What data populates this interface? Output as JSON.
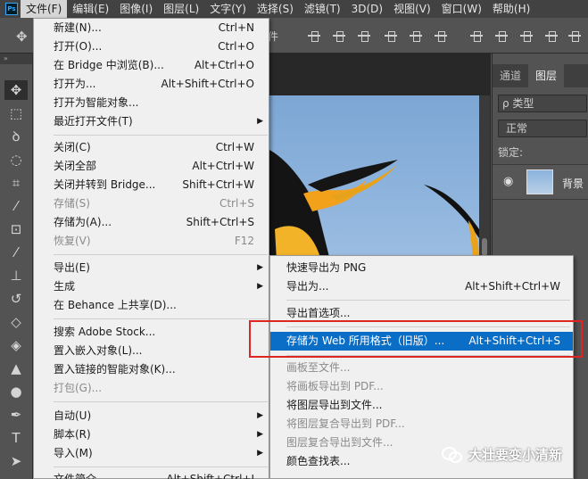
{
  "app": {
    "logo": "Ps"
  },
  "menubar": [
    "文件(F)",
    "编辑(E)",
    "图像(I)",
    "图层(L)",
    "文字(Y)",
    "选择(S)",
    "滤镜(T)",
    "3D(D)",
    "视图(V)",
    "窗口(W)",
    "帮助(H)"
  ],
  "optbar": {
    "text": "件"
  },
  "file_menu": [
    {
      "label": "新建(N)...",
      "shortcut": "Ctrl+N"
    },
    {
      "label": "打开(O)...",
      "shortcut": "Ctrl+O"
    },
    {
      "label": "在 Bridge 中浏览(B)...",
      "shortcut": "Alt+Ctrl+O"
    },
    {
      "label": "打开为...",
      "shortcut": "Alt+Shift+Ctrl+O"
    },
    {
      "label": "打开为智能对象...",
      "shortcut": ""
    },
    {
      "label": "最近打开文件(T)",
      "shortcut": ""
    },
    {
      "label": "关闭(C)",
      "shortcut": "Ctrl+W"
    },
    {
      "label": "关闭全部",
      "shortcut": "Alt+Ctrl+W"
    },
    {
      "label": "关闭并转到 Bridge...",
      "shortcut": "Shift+Ctrl+W"
    },
    {
      "label": "存储(S)",
      "shortcut": "Ctrl+S"
    },
    {
      "label": "存储为(A)...",
      "shortcut": "Shift+Ctrl+S"
    },
    {
      "label": "恢复(V)",
      "shortcut": "F12"
    },
    {
      "label": "导出(E)",
      "shortcut": ""
    },
    {
      "label": "生成",
      "shortcut": ""
    },
    {
      "label": "在 Behance 上共享(D)...",
      "shortcut": ""
    },
    {
      "label": "搜索 Adobe Stock...",
      "shortcut": ""
    },
    {
      "label": "置入嵌入对象(L)...",
      "shortcut": ""
    },
    {
      "label": "置入链接的智能对象(K)...",
      "shortcut": ""
    },
    {
      "label": "打包(G)...",
      "shortcut": ""
    },
    {
      "label": "自动(U)",
      "shortcut": ""
    },
    {
      "label": "脚本(R)",
      "shortcut": ""
    },
    {
      "label": "导入(M)",
      "shortcut": ""
    },
    {
      "label": "文件简介",
      "shortcut": "Alt+Shift+Ctrl+I"
    }
  ],
  "export_submenu": [
    {
      "label": "快速导出为 PNG",
      "shortcut": ""
    },
    {
      "label": "导出为...",
      "shortcut": "Alt+Shift+Ctrl+W"
    },
    {
      "label": "导出首选项...",
      "shortcut": ""
    },
    {
      "label": "存储为 Web 所用格式（旧版）...",
      "shortcut": "Alt+Shift+Ctrl+S"
    },
    {
      "label": "画板至文件...",
      "shortcut": ""
    },
    {
      "label": "将画板导出到 PDF...",
      "shortcut": ""
    },
    {
      "label": "将图层导出到文件...",
      "shortcut": ""
    },
    {
      "label": "将图层复合导出到 PDF...",
      "shortcut": ""
    },
    {
      "label": "图层复合导出到文件...",
      "shortcut": ""
    },
    {
      "label": "颜色查找表...",
      "shortcut": ""
    }
  ],
  "panel": {
    "tabs": [
      "通道",
      "图层"
    ],
    "kind": "ρ 类型",
    "blend": "正常",
    "lock": "锁定:",
    "layer_name": "背景"
  },
  "watermark": {
    "text": "大壮要变小清新"
  },
  "colors": {
    "menu_bg": "#f0f0f0",
    "highlight": "#0b6ec6",
    "annotation_box": "#e02424",
    "ui_dark": "#535353"
  }
}
